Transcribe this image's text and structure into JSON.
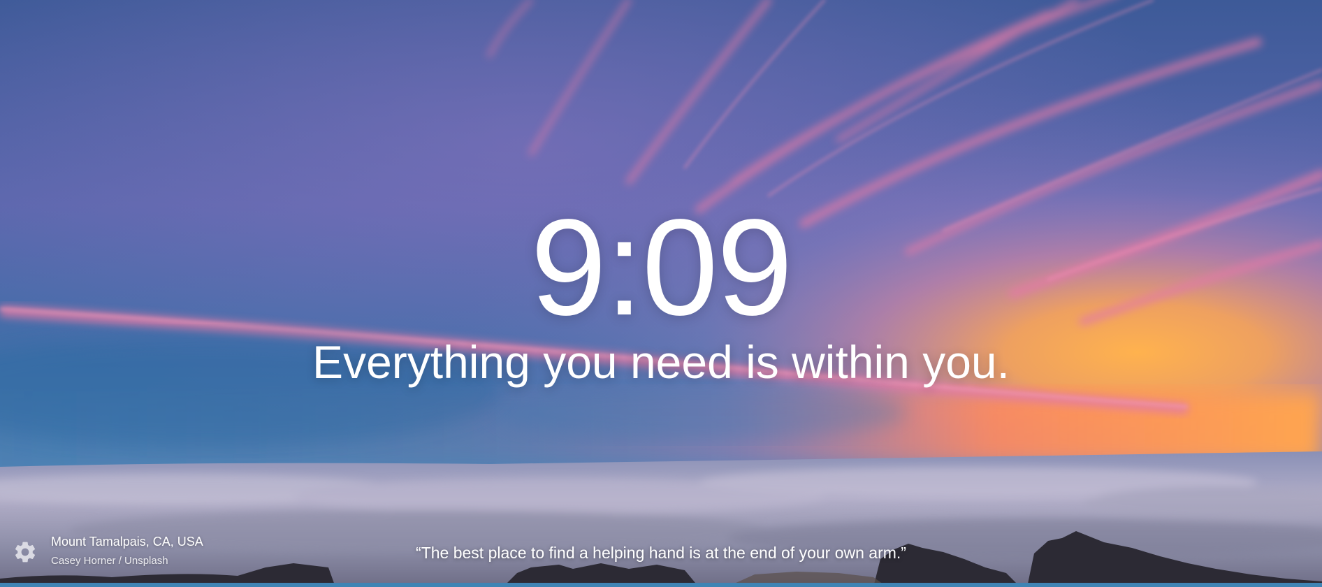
{
  "background": {
    "sky_top_color": "#3b5f99",
    "sky_mid_color": "#6a6fb5",
    "horizon_warm_color": "#f59a45",
    "cloud_sea_color": "#a9a6c2",
    "streak_color": "#e27aa6"
  },
  "clock": {
    "time": "9:09"
  },
  "mantra": {
    "text": "Everything you need is within you."
  },
  "photo": {
    "location": "Mount Tamalpais, CA, USA",
    "credit": "Casey Horner / Unsplash"
  },
  "quote": {
    "text": "“The best place to find a helping hand is at the end of your own arm.”"
  },
  "settings": {
    "icon": "gear-icon"
  }
}
